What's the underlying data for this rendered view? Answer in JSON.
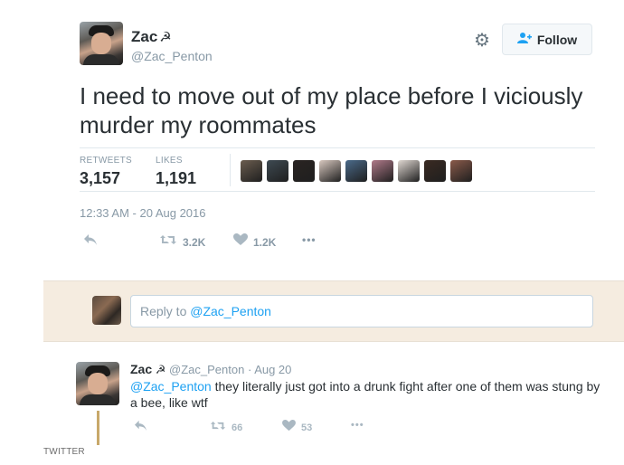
{
  "tweet": {
    "author_name": "Zac",
    "author_symbol": "☭",
    "handle": "@Zac_Penton",
    "follow_label": "Follow",
    "text": "I need to move out of my place before I viciously murder my roommates",
    "retweets_label": "RETWEETS",
    "retweets_count": "3,157",
    "likes_label": "LIKES",
    "likes_count": "1,191",
    "timestamp": "12:33 AM - 20 Aug 2016",
    "action_retweet_count": "3.2K",
    "action_like_count": "1.2K",
    "more_glyph": "•••",
    "facepile_colors": [
      "#6b5d4f",
      "#3e4a52",
      "#2a2422",
      "#d8c8bf",
      "#4a6a8a",
      "#b07a8a",
      "#e0d8d2",
      "#3a2a22",
      "#8a5a4a"
    ]
  },
  "reply_box": {
    "prefix": "Reply to ",
    "mention": "@Zac_Penton"
  },
  "reply": {
    "author_name": "Zac",
    "author_symbol": "☭",
    "handle": "@Zac_Penton",
    "date": "· Aug 20",
    "mention": "@Zac_Penton",
    "text": " they literally just got into a drunk fight after one of them was stung by a bee, like wtf",
    "retweet_count": "66",
    "like_count": "53",
    "more_glyph": "•••"
  },
  "credit": "TWITTER",
  "colors": {
    "accent": "#1da1f2",
    "reply_bg": "#f5ece0",
    "thread_line": "#c8a86a"
  }
}
